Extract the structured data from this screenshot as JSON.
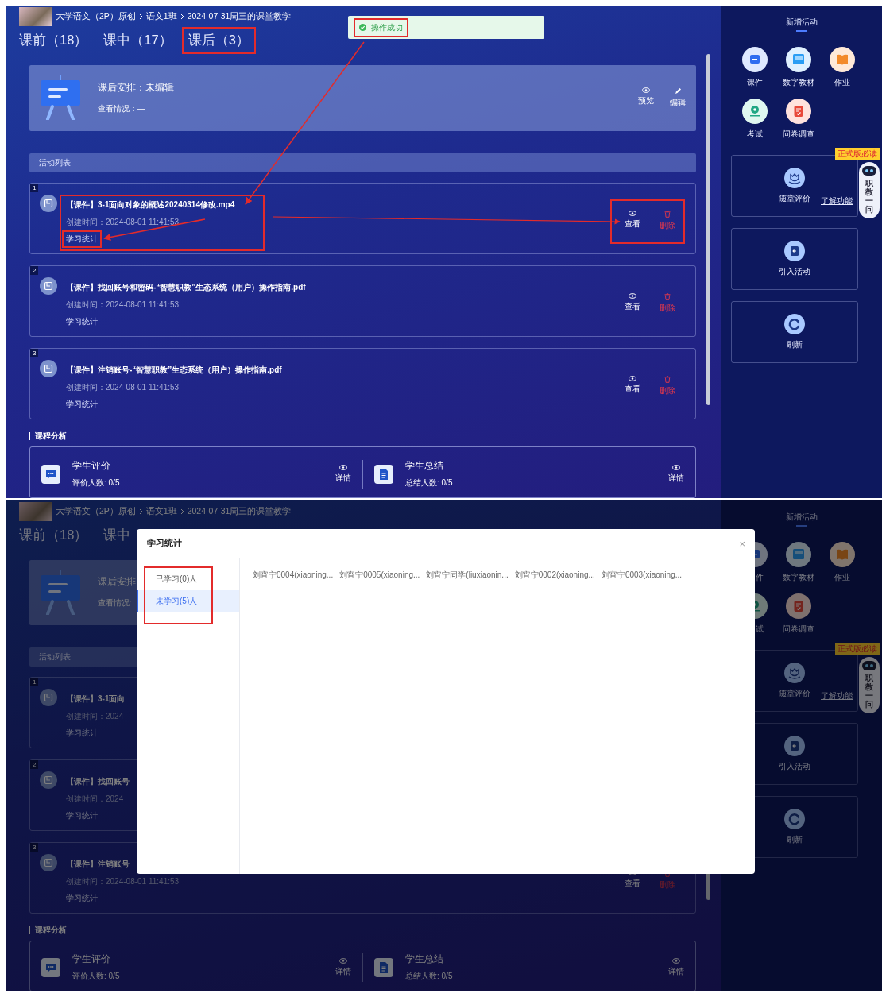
{
  "screens": [
    {
      "show_arrows": true,
      "breadcrumb": [
        "大学语文（2P）原创",
        "语文1班",
        "2024-07-31周三的课堂教学"
      ],
      "tabs": [
        {
          "label": "课前（18）",
          "highlighted": false
        },
        {
          "label": "课中（17）",
          "highlighted": false
        },
        {
          "label": "课后（3）",
          "highlighted": true
        }
      ],
      "toast": {
        "text": "操作成功",
        "highlighted": true
      },
      "arrangement": {
        "title": "课后安排：未编辑",
        "status": "查看情况：—",
        "actions": [
          {
            "kind": "preview",
            "label": "预览"
          },
          {
            "kind": "edit",
            "label": "编辑"
          }
        ]
      },
      "activity_list": {
        "title": "活动列表",
        "rows": [
          {
            "index": "1",
            "title": "【课件】3-1面向对象的概述20240314修改.mp4",
            "created": "创建时间：2024-08-01 11:41:53",
            "stats_link": "学习统计",
            "highlighted": true,
            "stats_highlighted": true,
            "actions_highlighted": true,
            "actions": [
              {
                "kind": "view",
                "label": "查看"
              },
              {
                "kind": "delete",
                "label": "删除"
              }
            ]
          },
          {
            "index": "2",
            "title": "【课件】找回账号和密码-“智慧职教”生态系统（用户）操作指南.pdf",
            "created": "创建时间：2024-08-01 11:41:53",
            "stats_link": "学习统计",
            "highlighted": false,
            "stats_highlighted": false,
            "actions_highlighted": false,
            "actions": [
              {
                "kind": "view",
                "label": "查看"
              },
              {
                "kind": "delete",
                "label": "删除"
              }
            ]
          },
          {
            "index": "3",
            "title": "【课件】注销账号-“智慧职教”生态系统（用户）操作指南.pdf",
            "created": "创建时间：2024-08-01 11:41:53",
            "stats_link": "学习统计",
            "highlighted": false,
            "stats_highlighted": false,
            "actions_highlighted": false,
            "actions": [
              {
                "kind": "view",
                "label": "查看"
              },
              {
                "kind": "delete",
                "label": "删除"
              }
            ]
          }
        ]
      },
      "analysis": {
        "title": "课程分析",
        "items": [
          {
            "kind": "comment",
            "title": "学生评价",
            "count": "评价人数: 0/5",
            "action": "详情"
          },
          {
            "kind": "document",
            "title": "学生总结",
            "count": "总结人数: 0/5",
            "action": "详情"
          }
        ]
      },
      "sidebar": {
        "title": "新增活动",
        "tools": [
          {
            "kind": "courseware",
            "label": "课件",
            "clipped": false
          },
          {
            "kind": "textbook",
            "label": "数字教材",
            "clipped": false
          },
          {
            "kind": "homework",
            "label": "作业",
            "clipped": false
          },
          {
            "kind": "exam",
            "label": "考试",
            "clipped": false
          },
          {
            "kind": "survey",
            "label": "问卷调查",
            "clipped": false
          }
        ],
        "boxes": [
          {
            "kind": "evaluation",
            "label": "随堂评价",
            "link": "了解功能"
          },
          {
            "kind": "import",
            "label": "引入活动"
          },
          {
            "kind": "refresh",
            "label": "刷新"
          }
        ],
        "widget": {
          "badge": "正式版必读",
          "label": "职教一问"
        }
      }
    },
    {
      "breadcrumb": [
        "大学语文（2P）原创",
        "语文1班",
        "2024-07-31周三的课堂教学"
      ],
      "tabs": [
        {
          "label": "课前（18）",
          "highlighted": false
        },
        {
          "label": "课中",
          "highlighted": false
        }
      ],
      "arrangement": {
        "title": "课后安排",
        "status": "查看情况:"
      },
      "activity_list": {
        "title": "活动列表",
        "rows": [
          {
            "index": "1",
            "title": "【课件】3-1面向",
            "created": "创建时间：2024",
            "stats_link": "学习统计",
            "highlighted": false,
            "stats_highlighted": false
          },
          {
            "index": "2",
            "title": "【课件】找回账号",
            "created": "创建时间：2024",
            "stats_link": "学习统计",
            "highlighted": false,
            "stats_highlighted": false
          },
          {
            "index": "3",
            "title": "【课件】注销账号",
            "created": "创建时间：2024-08-01 11:41:53",
            "stats_link": "学习统计",
            "highlighted": false,
            "stats_highlighted": false,
            "actions_highlighted": false,
            "actions": [
              {
                "kind": "view",
                "label": "查看"
              },
              {
                "kind": "delete",
                "label": "删除"
              }
            ]
          }
        ]
      },
      "analysis": {
        "title": "课程分析",
        "items": [
          {
            "kind": "comment",
            "title": "学生评价",
            "count": "评价人数: 0/5",
            "action": "详情"
          },
          {
            "kind": "document",
            "title": "学生总结",
            "count": "总结人数: 0/5",
            "action": "详情"
          }
        ]
      },
      "sidebar": {
        "title": "新增活动",
        "tools": [
          {
            "kind": "courseware",
            "label": "件",
            "clipped": true
          },
          {
            "kind": "textbook",
            "label": "数字教材",
            "clipped": false
          },
          {
            "kind": "homework",
            "label": "作业",
            "clipped": false
          },
          {
            "kind": "exam",
            "label": "试",
            "clipped": true
          },
          {
            "kind": "survey",
            "label": "问卷调查",
            "clipped": false
          }
        ],
        "boxes": [
          {
            "kind": "evaluation",
            "label": "随堂评价",
            "link": "了解功能"
          },
          {
            "kind": "import",
            "label": "引入活动"
          },
          {
            "kind": "refresh",
            "label": "刷新"
          }
        ],
        "widget": {
          "badge": "正式版必读",
          "label": "职教一问"
        }
      },
      "modal": {
        "title": "学习统计",
        "close": "×",
        "tabs_highlighted": true,
        "tabs": [
          {
            "label": "已学习(0)人",
            "selected": false
          },
          {
            "label": "未学习(5)人",
            "selected": true
          }
        ],
        "names": [
          "刘宵宁0004(xiaoning...",
          "刘宵宁0005(xiaoning...",
          "刘宵宁同学(liuxiaonin...",
          "刘宵宁0002(xiaoning...",
          "刘宵宁0003(xiaoning..."
        ]
      }
    }
  ]
}
